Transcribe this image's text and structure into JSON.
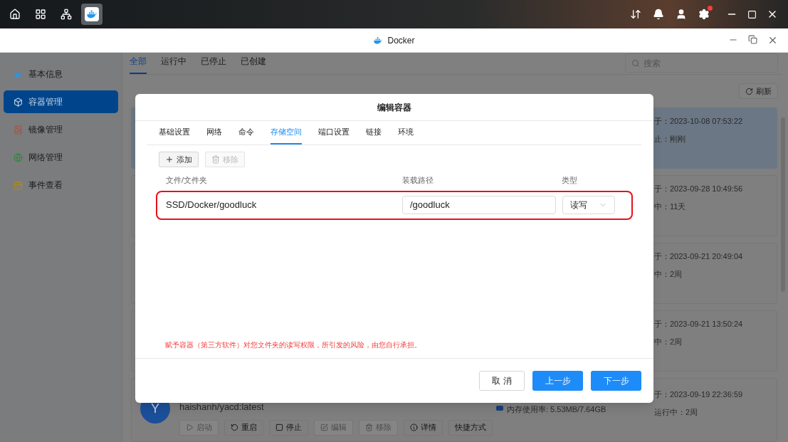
{
  "taskbar": [
    {
      "kind": "home",
      "selected": false
    },
    {
      "kind": "grid",
      "selected": false
    },
    {
      "kind": "network",
      "selected": false
    },
    {
      "kind": "docker",
      "selected": true
    }
  ],
  "tray": [
    {
      "kind": "transfer",
      "badge": false
    },
    {
      "kind": "bell",
      "badge": false
    },
    {
      "kind": "user",
      "badge": false
    },
    {
      "kind": "gear",
      "badge": true
    }
  ],
  "window": {
    "title": "Docker"
  },
  "sidebar": {
    "items": [
      {
        "label": "基本信息",
        "kind": "docker",
        "selected": false
      },
      {
        "label": "容器管理",
        "kind": "box",
        "selected": true
      },
      {
        "label": "镜像管理",
        "kind": "image",
        "selected": false
      },
      {
        "label": "网络管理",
        "kind": "globe",
        "selected": false
      },
      {
        "label": "事件查看",
        "kind": "log",
        "selected": false
      }
    ]
  },
  "filter_tabs": [
    {
      "label": "全部",
      "selected": true
    },
    {
      "label": "运行中",
      "selected": false
    },
    {
      "label": "已停止",
      "selected": false
    },
    {
      "label": "已创建",
      "selected": false
    }
  ],
  "search": {
    "placeholder": "搜索"
  },
  "refresh_button": "刷新",
  "containers": [
    {
      "selected": true,
      "lines": [
        "于：2023-10-08 07:53:22",
        "止：刚刚"
      ]
    },
    {
      "selected": false,
      "lines": [
        "于：2023-09-28 10:49:56",
        "中：11天"
      ]
    },
    {
      "selected": false,
      "lines": [
        "于：2023-09-21 20:49:04",
        "中：2周"
      ]
    },
    {
      "selected": false,
      "lines": [
        "于：2023-09-21 13:50:24",
        "中：2周"
      ]
    },
    {
      "selected": false,
      "lines": [
        "于：2023-09-19 22:36:59",
        "运行中：2周"
      ],
      "avatar": "Y",
      "image": "haishanh/yacd:latest",
      "memory": "内存使用率: 5.53MB/7.64GB",
      "actions": [
        {
          "label": "启动",
          "kind": "play",
          "disabled": true
        },
        {
          "label": "重启",
          "kind": "restart",
          "disabled": false
        },
        {
          "label": "停止",
          "kind": "stop",
          "disabled": false
        },
        {
          "label": "编辑",
          "kind": "edit",
          "disabled": true
        },
        {
          "label": "移除",
          "kind": "trash",
          "disabled": true
        },
        {
          "label": "详情",
          "kind": "info",
          "disabled": false
        },
        {
          "label": "快捷方式",
          "kind": "none",
          "disabled": false
        }
      ]
    }
  ],
  "dialog": {
    "title": "编辑容器",
    "tabs": [
      {
        "label": "基础设置",
        "selected": false
      },
      {
        "label": "网络",
        "selected": false
      },
      {
        "label": "命令",
        "selected": false
      },
      {
        "label": "存储空间",
        "selected": true
      },
      {
        "label": "端口设置",
        "selected": false
      },
      {
        "label": "链接",
        "selected": false
      },
      {
        "label": "环境",
        "selected": false
      }
    ],
    "toolbar": [
      {
        "label": "添加",
        "kind": "plus",
        "disabled": false
      },
      {
        "label": "移除",
        "kind": "trash",
        "disabled": true
      }
    ],
    "columns": [
      "文件/文件夹",
      "装载路径",
      "类型"
    ],
    "rows": [
      {
        "path": "SSD/Docker/goodluck",
        "mount": "/goodluck",
        "type": "读写",
        "highlighted": true
      }
    ],
    "warning": "赋予容器（第三方软件）对您文件夹的读写权限，所引发的风险，由您自行承担。",
    "buttons": [
      {
        "label": "取 消",
        "kind": "secondary"
      },
      {
        "label": "上一步",
        "kind": "primary"
      },
      {
        "label": "下一步",
        "kind": "primary"
      }
    ]
  }
}
